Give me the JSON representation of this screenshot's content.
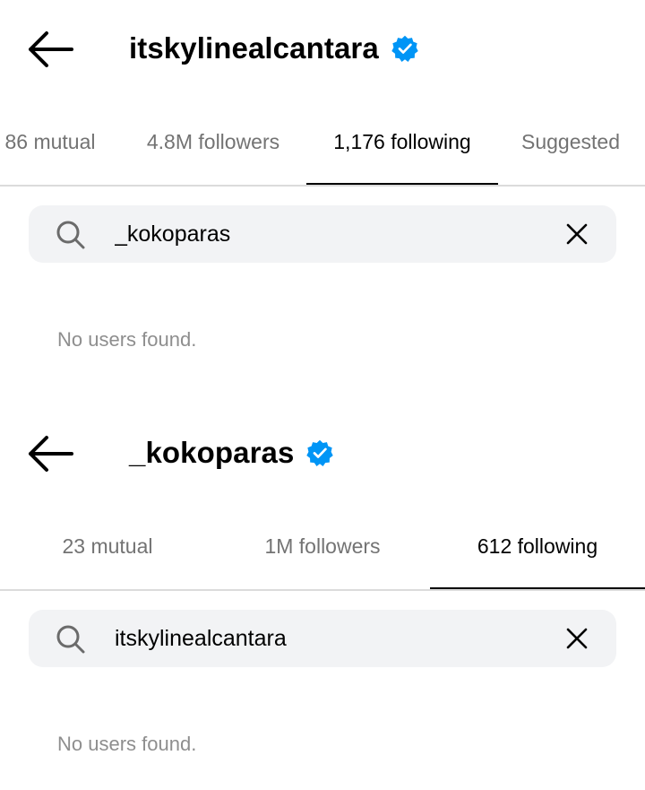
{
  "panels": [
    {
      "title": "itskylinealcantara",
      "tabs": [
        {
          "label": "86 mutual"
        },
        {
          "label": "4.8M followers"
        },
        {
          "label": "1,176 following"
        },
        {
          "label": "Suggested"
        }
      ],
      "search": {
        "value": "_kokoparas"
      },
      "empty_text": "No users found."
    },
    {
      "title": "_kokoparas",
      "tabs": [
        {
          "label": "23 mutual"
        },
        {
          "label": "1M followers"
        },
        {
          "label": "612 following"
        }
      ],
      "search": {
        "value": "itskylinealcantara"
      },
      "empty_text": "No users found."
    }
  ],
  "colors": {
    "verified": "#0095f6",
    "inactive_tab": "#737373",
    "search_bg": "#f2f3f5"
  },
  "icons": [
    "back-arrow-icon",
    "verified-badge-icon",
    "search-icon",
    "clear-icon"
  ]
}
